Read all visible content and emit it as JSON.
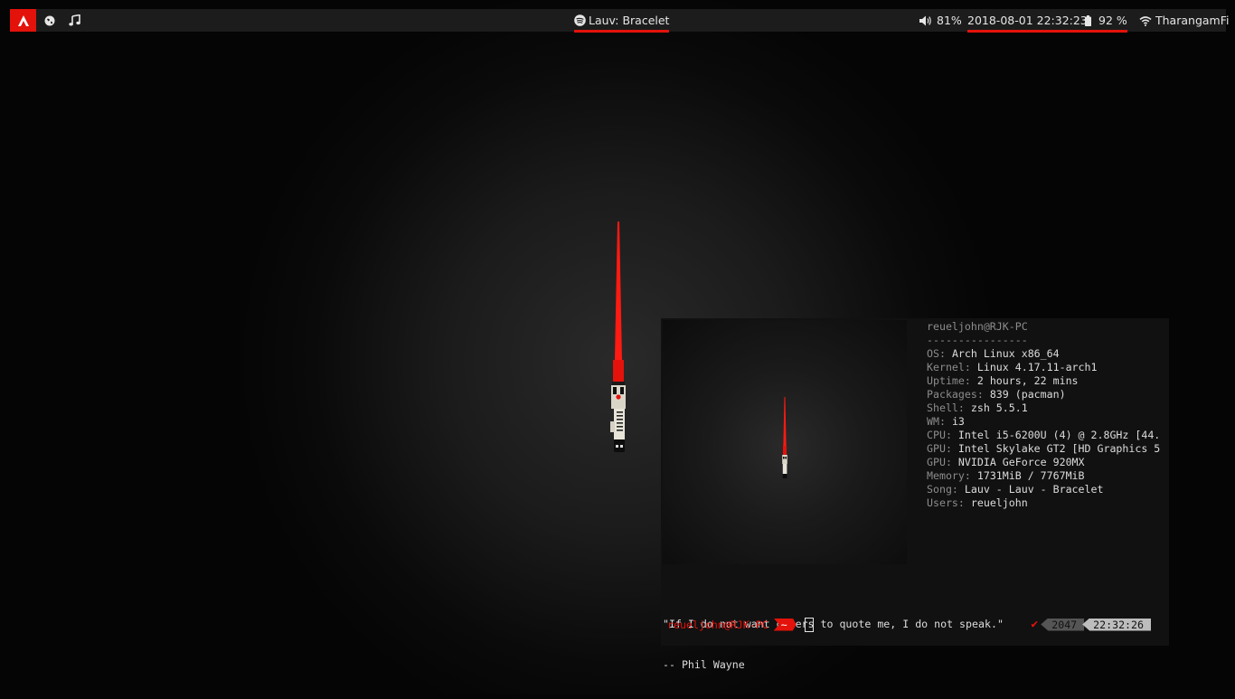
{
  "topbar": {
    "launcher_icon": "arch-logo-icon",
    "workspace_icon": "globe-icon",
    "music_icon": "music-note-icon",
    "spotify_icon": "spotify-icon",
    "now_playing": "Lauv: Bracelet",
    "volume_icon": "speaker-icon",
    "volume": "81%",
    "datetime": "2018-08-01 22:32:23",
    "battery_icon": "battery-icon",
    "battery": "92 %",
    "wifi_icon": "wifi-icon",
    "network": "TharangamFi",
    "accent": "#e3120b"
  },
  "terminal": {
    "header": "reueljohn@RJK-PC",
    "separator": "----------------",
    "info": [
      {
        "key": "OS",
        "value": "Arch Linux x86_64"
      },
      {
        "key": "Kernel",
        "value": "Linux 4.17.11-arch1"
      },
      {
        "key": "Uptime",
        "value": "2 hours, 22 mins"
      },
      {
        "key": "Packages",
        "value": "839 (pacman)"
      },
      {
        "key": "Shell",
        "value": "zsh 5.5.1"
      },
      {
        "key": "WM",
        "value": "i3"
      },
      {
        "key": "CPU",
        "value": "Intel i5-6200U (4) @ 2.8GHz [44."
      },
      {
        "key": "GPU",
        "value": "Intel Skylake GT2 [HD Graphics 5"
      },
      {
        "key": "GPU",
        "value": "NVIDIA GeForce 920MX"
      },
      {
        "key": "Memory",
        "value": "1731MiB / 7767MiB"
      },
      {
        "key": "Song",
        "value": "Lauv - Lauv - Bracelet"
      },
      {
        "key": "Users",
        "value": "reueljohn"
      }
    ],
    "quote_line1": "\"If I do not want others to quote me, I do not speak.\"",
    "quote_line2": "-- Phil Wayne",
    "prompt_user": "reueljohn@RJK-PC",
    "prompt_dir": "~",
    "status_check": "✔",
    "history_number": "2047",
    "clock": "22:32:26"
  }
}
